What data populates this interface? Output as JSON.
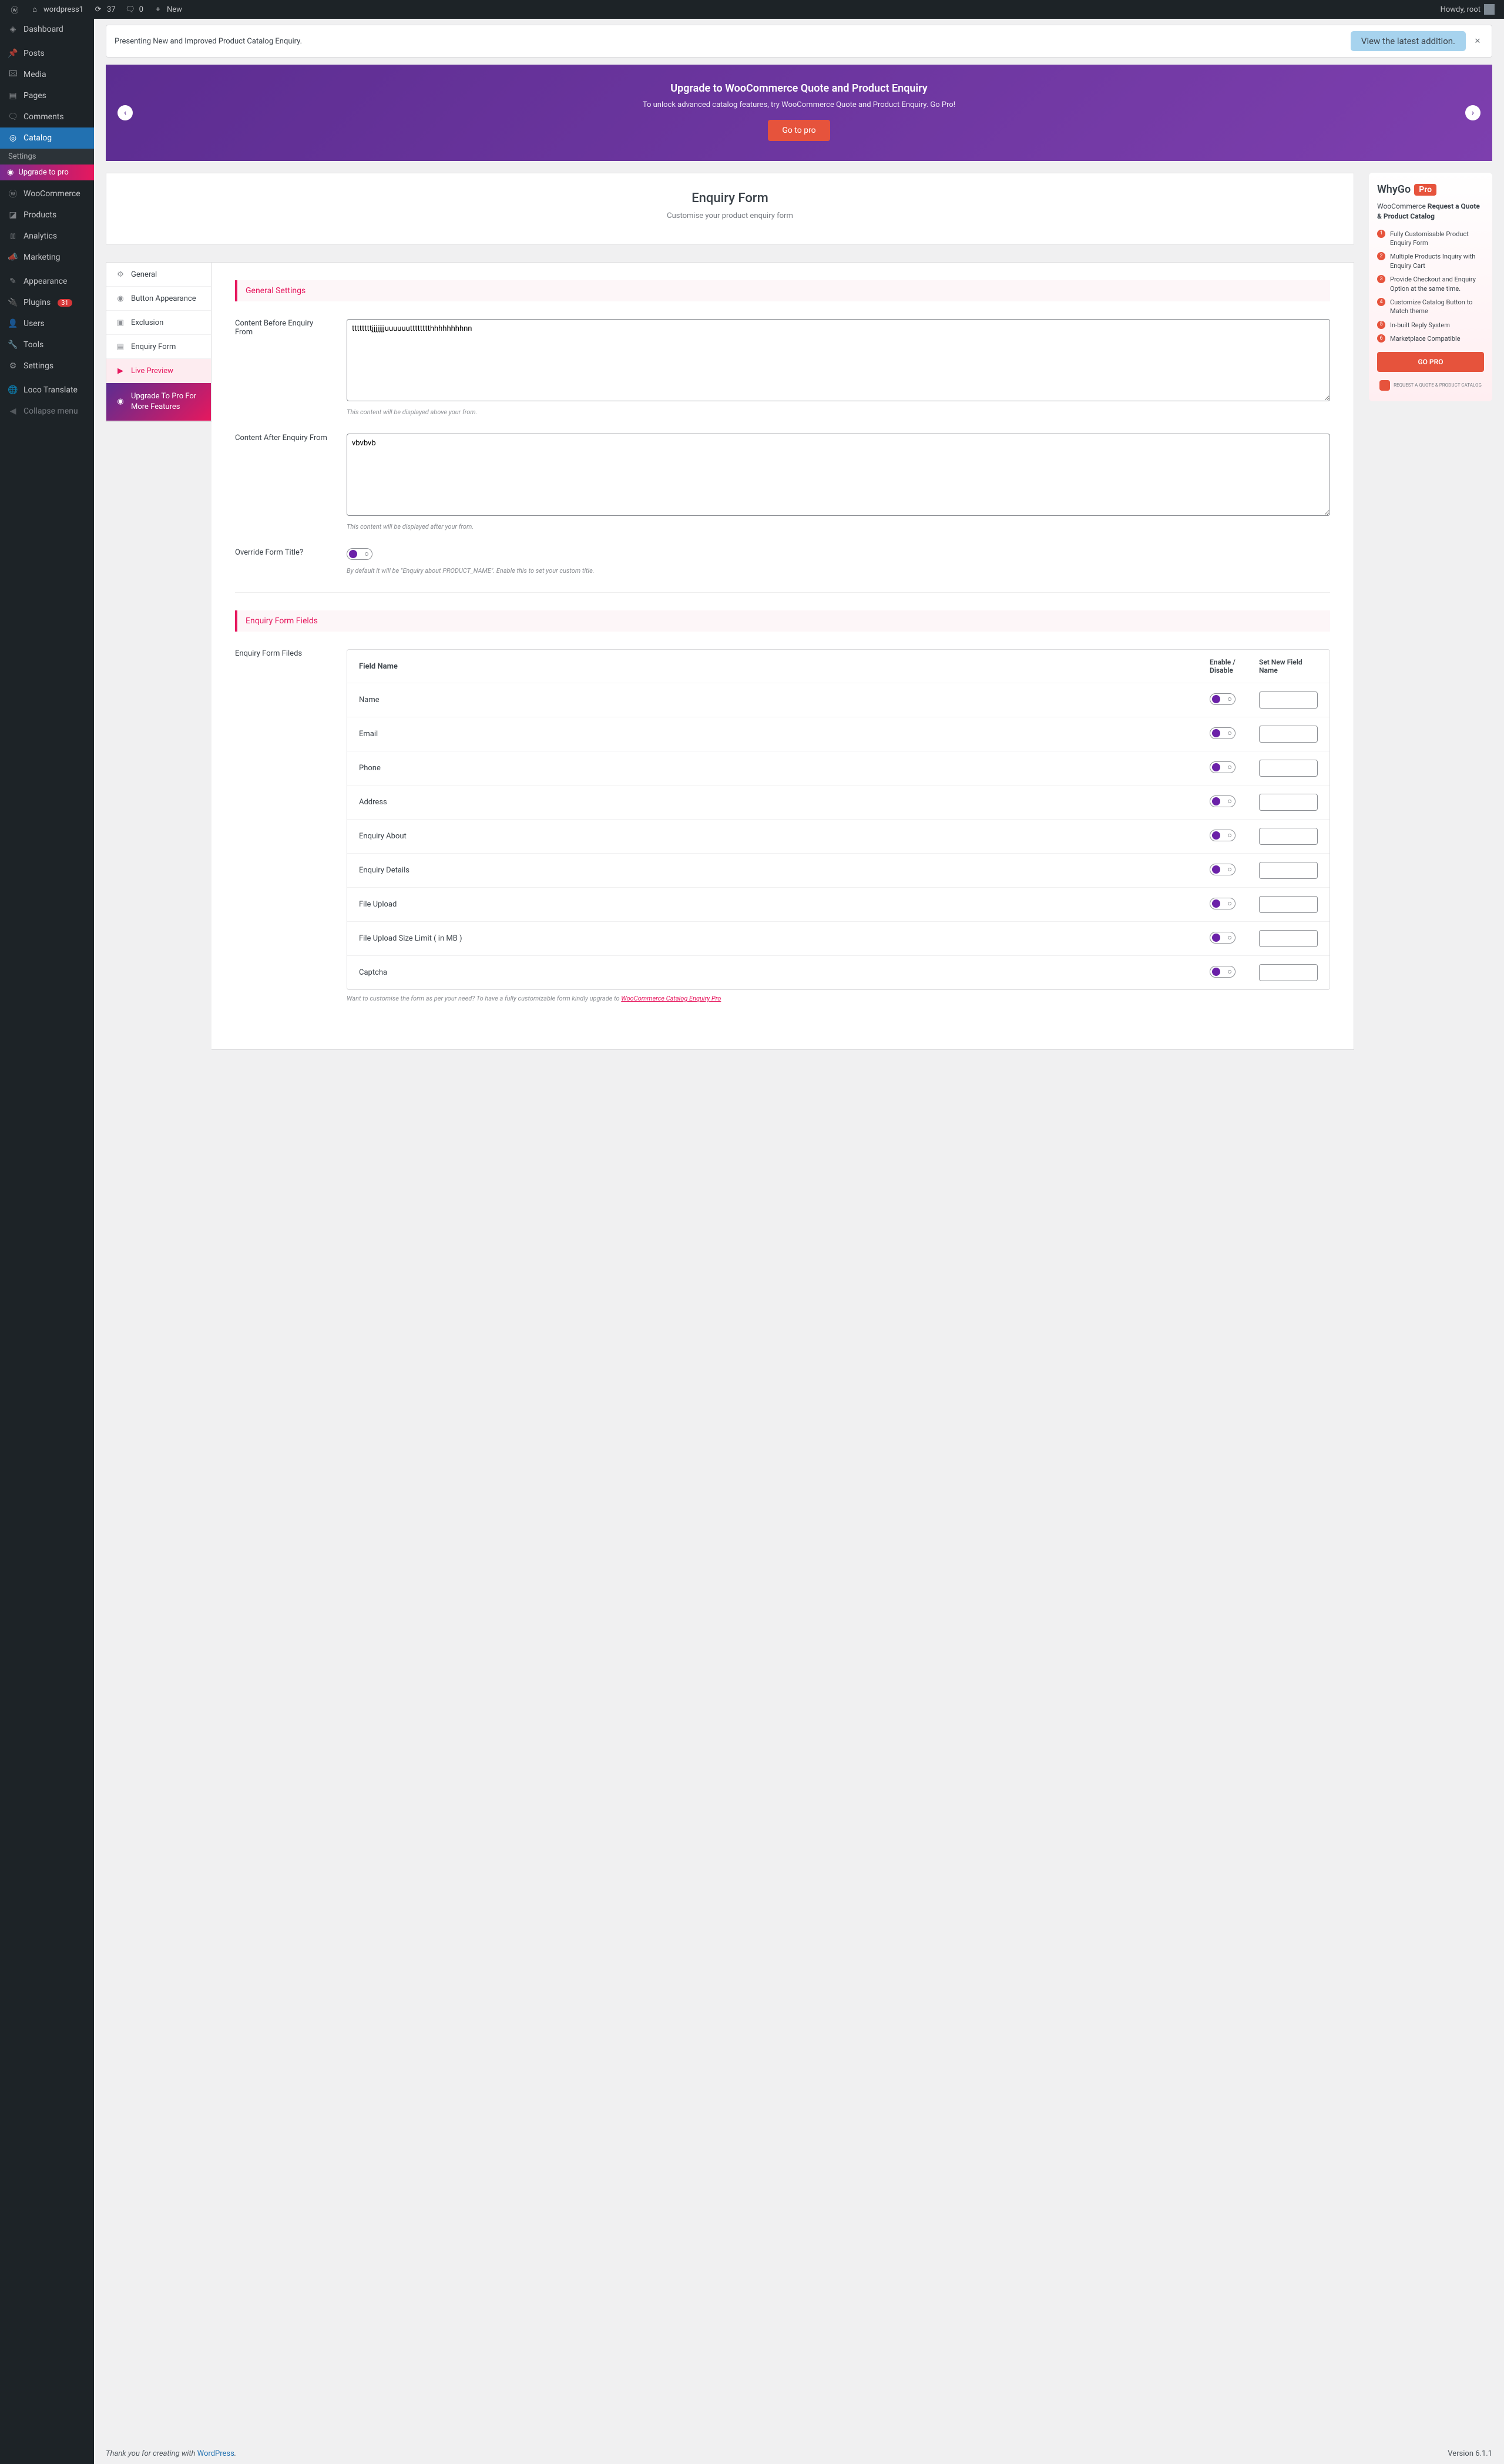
{
  "adminbar": {
    "site": "wordpress1",
    "updates": "37",
    "comments": "0",
    "new": "New",
    "howdy": "Howdy, root"
  },
  "sidemenu": {
    "dashboard": "Dashboard",
    "posts": "Posts",
    "media": "Media",
    "pages": "Pages",
    "comments": "Comments",
    "catalog": "Catalog",
    "catalog_sub_settings": "Settings",
    "catalog_sub_upgrade": "Upgrade to pro",
    "woocommerce": "WooCommerce",
    "products": "Products",
    "analytics": "Analytics",
    "marketing": "Marketing",
    "appearance": "Appearance",
    "plugins": "Plugins",
    "plugins_count": "31",
    "users": "Users",
    "tools": "Tools",
    "settings": "Settings",
    "loco": "Loco Translate",
    "collapse": "Collapse menu"
  },
  "notice": {
    "text": "Presenting New and Improved Product Catalog Enquiry.",
    "button": "View the latest addition."
  },
  "hero": {
    "title": "Upgrade to WooCommerce Quote and Product Enquiry",
    "sub": "To unlock advanced catalog features, try WooCommerce Quote and Product Enquiry. Go Pro!",
    "button": "Go to pro"
  },
  "header": {
    "title": "Enquiry Form",
    "sub": "Customise your product enquiry form"
  },
  "tabs": {
    "general": "General",
    "button": "Button Appearance",
    "exclusion": "Exclusion",
    "enquiry": "Enquiry Form",
    "live": "Live Preview",
    "upgrade": "Upgrade To Pro For More Features"
  },
  "groups": {
    "general": "General Settings",
    "fields": "Enquiry Form Fields"
  },
  "fields": {
    "before_label": "Content Before Enquiry From",
    "before_value": "ttttttttjjjjjjjuuuuuutttttttthhhhhhhhnn",
    "before_hint": "This content will be displayed above your from.",
    "after_label": "Content After Enquiry From",
    "after_value": "vbvbvb",
    "after_hint": "This content will be displayed after your from.",
    "override_label": "Override Form Title?",
    "override_hint": "By default it will be \"Enquiry about PRODUCT_NAME\". Enable this to set your custom title.",
    "table_label": "Enquiry Form Fileds"
  },
  "table": {
    "h1": "Field Name",
    "h2": "Enable / Disable",
    "h3": "Set New Field Name",
    "rows": [
      "Name",
      "Email",
      "Phone",
      "Address",
      "Enquiry About",
      "Enquiry Details",
      "File Upload",
      "File Upload Size Limit ( in MB )",
      "Captcha"
    ]
  },
  "table_hint_pre": "Want to customise the form as per your need? To have a fully customizable form kindly upgrade to ",
  "table_hint_link": "WooCommerce Catalog Enquiry Pro",
  "promo": {
    "why": "WhyGo",
    "pro": "Pro",
    "sub_pre": "WooCommerce ",
    "sub_bold": "Request a Quote & Product Catalog",
    "items": [
      "Fully Customisable Product Enquiry Form",
      "Multiple Products Inquiry with Enquiry Cart",
      "Provide Checkout and Enquiry Option at the same time.",
      "Customize Catalog Button to Match theme",
      "In-built Reply System",
      "Marketplace Compatible"
    ],
    "button": "GO PRO",
    "req": "REQUEST A QUOTE & PRODUCT CATALOG"
  },
  "footer": {
    "thank_pre": "Thank you for creating with ",
    "wp": "WordPress",
    "version": "Version 6.1.1"
  }
}
